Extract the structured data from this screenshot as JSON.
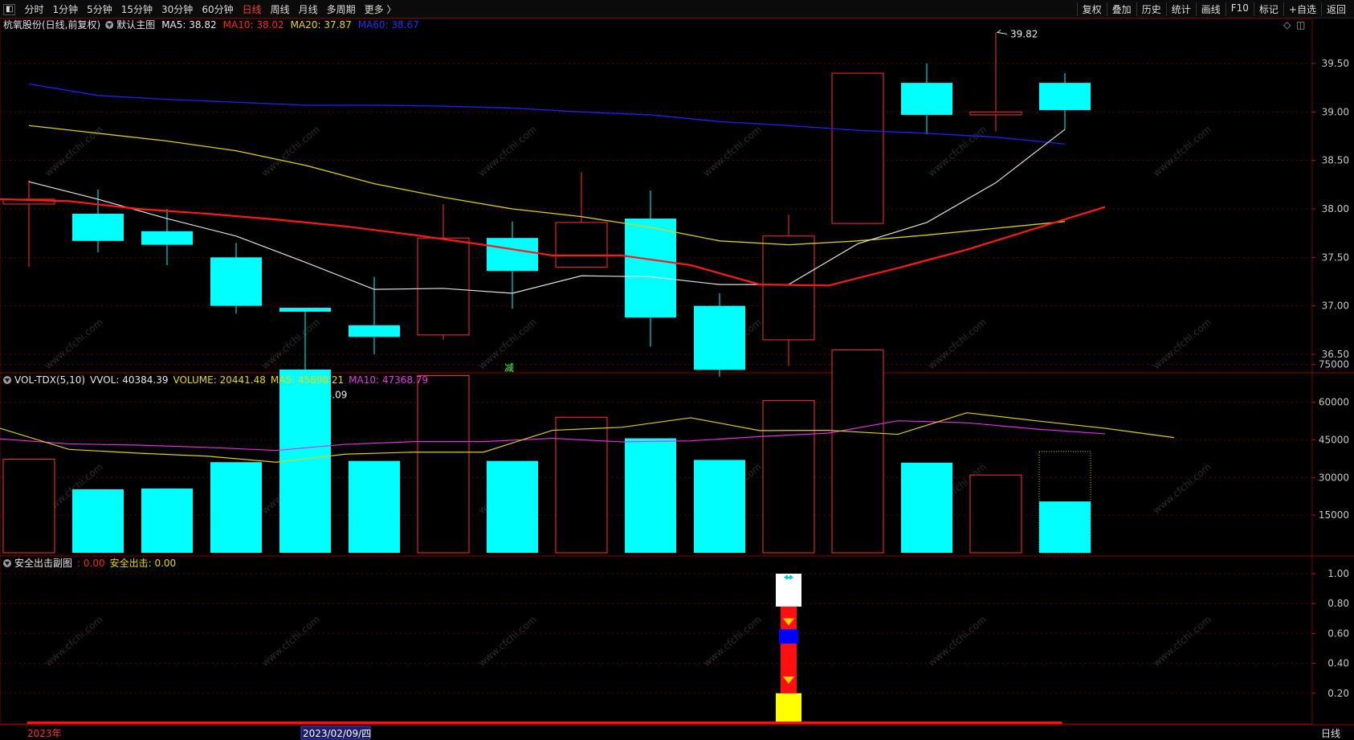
{
  "toolbar": {
    "periods": [
      {
        "label": "分时",
        "active": false
      },
      {
        "label": "1分钟",
        "active": false
      },
      {
        "label": "5分钟",
        "active": false
      },
      {
        "label": "15分钟",
        "active": false
      },
      {
        "label": "30分钟",
        "active": false
      },
      {
        "label": "60分钟",
        "active": false
      },
      {
        "label": "日线",
        "active": true
      },
      {
        "label": "周线",
        "active": false
      },
      {
        "label": "月线",
        "active": false
      },
      {
        "label": "多周期",
        "active": false
      },
      {
        "label": "更多 〉",
        "active": false
      }
    ],
    "tools": [
      "复权",
      "叠加",
      "历史",
      "统计",
      "画线",
      "F10",
      "标记",
      "+自选",
      "返回"
    ]
  },
  "main_panel": {
    "title": "杭氧股份(日线,前复权)",
    "indicator": "默认主图",
    "legend": [
      {
        "label": "MA5: 38.82",
        "color": "#e8e8e8"
      },
      {
        "label": "MA10: 38.02",
        "color": "#ff2020"
      },
      {
        "label": "MA20: 37.87",
        "color": "#e8d800"
      },
      {
        "label": "MA60: 38.67",
        "color": "#2a2aff"
      }
    ],
    "high_label": "39.82",
    "low_label": "36.09",
    "marker": "减",
    "yticks": [
      "39.50",
      "39.00",
      "38.50",
      "38.00",
      "37.50",
      "37.00",
      "36.50"
    ]
  },
  "volume_panel": {
    "legend": [
      {
        "label": "VOL-TDX(5,10)",
        "color": "#e8e8e8"
      },
      {
        "label": "VVOL: 40384.39",
        "color": "#e8e8e8"
      },
      {
        "label": "VOLUME: 20441.48",
        "color": "#e8d800"
      },
      {
        "label": "MA5: 45898.21",
        "color": "#e8d800"
      },
      {
        "label": "MA10: 47368.79",
        "color": "#e040e0"
      }
    ],
    "yticks": [
      "75000",
      "60000",
      "45000",
      "30000",
      "15000"
    ]
  },
  "sub_panel": {
    "legend": [
      {
        "label": "安全出击副图",
        "color": "#e8e8e8"
      },
      {
        "label": ": 0.00",
        "color": "#ff2020"
      },
      {
        "label": "安全出击: 0.00",
        "color": "#e8d800"
      }
    ],
    "yticks": [
      "1.00",
      "0.80",
      "0.60",
      "0.40",
      "0.20"
    ]
  },
  "footer": {
    "year_label": "2023年",
    "cursor_date": "2023/02/09/四",
    "period_label": "日线"
  },
  "watermark": "www.cfchi.com",
  "chart_data": {
    "type": "candlestick",
    "price": {
      "ylim": [
        36.0,
        39.8
      ],
      "candles": [
        {
          "open": 38.05,
          "close": 38.1,
          "high": 38.3,
          "low": 37.4
        },
        {
          "open": 37.95,
          "close": 37.67,
          "high": 38.2,
          "low": 37.55
        },
        {
          "open": 37.77,
          "close": 37.63,
          "high": 38.0,
          "low": 37.42
        },
        {
          "open": 37.5,
          "close": 37.0,
          "high": 37.65,
          "low": 36.92
        },
        {
          "open": 36.98,
          "close": 36.94,
          "high": 36.98,
          "low": 36.09
        },
        {
          "open": 36.8,
          "close": 36.68,
          "high": 37.3,
          "low": 36.5
        },
        {
          "open": 36.7,
          "close": 37.7,
          "high": 38.05,
          "low": 36.65
        },
        {
          "open": 37.7,
          "close": 37.36,
          "high": 37.87,
          "low": 36.97
        },
        {
          "open": 37.4,
          "close": 37.86,
          "high": 38.38,
          "low": 37.4
        },
        {
          "open": 37.9,
          "close": 36.88,
          "high": 38.19,
          "low": 36.58
        },
        {
          "open": 37.0,
          "close": 36.34,
          "high": 37.13,
          "low": 36.27
        },
        {
          "open": 36.65,
          "close": 37.72,
          "high": 37.94,
          "low": 36.38
        },
        {
          "open": 37.85,
          "close": 39.4,
          "high": 39.4,
          "low": 37.85
        },
        {
          "open": 39.3,
          "close": 38.97,
          "high": 39.5,
          "low": 38.77
        },
        {
          "open": 38.97,
          "close": 39.0,
          "high": 39.82,
          "low": 38.8
        },
        {
          "open": 39.3,
          "close": 39.02,
          "high": 39.4,
          "low": 38.82
        }
      ],
      "ma5": [
        38.28,
        38.1,
        37.9,
        37.72,
        37.45,
        37.17,
        37.18,
        37.13,
        37.31,
        37.3,
        37.22,
        37.22,
        37.64,
        37.86,
        38.27,
        38.82
      ],
      "ma10": [
        38.1,
        38.08,
        38.0,
        37.95,
        37.89,
        37.82,
        37.73,
        37.63,
        37.52,
        37.52,
        37.42,
        37.22,
        37.21,
        37.39,
        37.58,
        37.8,
        38.02
      ],
      "ma20": [
        38.86,
        38.78,
        38.7,
        38.6,
        38.45,
        38.26,
        38.12,
        38.0,
        37.92,
        37.81,
        37.67,
        37.63,
        37.67,
        37.73,
        37.8,
        37.87
      ],
      "ma60": [
        39.29,
        39.17,
        39.13,
        39.1,
        39.07,
        39.07,
        39.06,
        39.04,
        39.0,
        38.97,
        38.9,
        38.86,
        38.81,
        38.78,
        38.74,
        38.67
      ]
    },
    "volume": {
      "ylim": [
        0,
        85000
      ],
      "bars": [
        37300,
        25300,
        25600,
        36100,
        73000,
        36600,
        70600,
        36600,
        54000,
        45600,
        37000,
        60700,
        80800,
        35900,
        31000,
        40384
      ],
      "volume_last": 20441,
      "up": [
        true,
        false,
        false,
        false,
        false,
        false,
        true,
        false,
        true,
        false,
        false,
        true,
        true,
        false,
        true,
        true
      ],
      "ma5": [
        49600,
        41200,
        39700,
        38500,
        36100,
        39300,
        40100,
        40100,
        48800,
        50000,
        53800,
        48700,
        48800,
        47200,
        55800,
        52600,
        49600,
        45900
      ],
      "ma10": [
        45400,
        43400,
        42900,
        42000,
        40800,
        43200,
        44300,
        44300,
        45600,
        44200,
        44600,
        46300,
        47700,
        52600,
        51800,
        49300,
        47400
      ]
    },
    "signal": {
      "ylim": [
        0,
        1.1
      ],
      "candle_index": 11,
      "segments": [
        {
          "from": 0.0,
          "to": 0.2,
          "color": "#ffff00"
        },
        {
          "from": 0.2,
          "to": 0.78,
          "color": "#ff1010"
        },
        {
          "from": 0.78,
          "to": 1.0,
          "color": "#ffffff"
        }
      ]
    }
  }
}
